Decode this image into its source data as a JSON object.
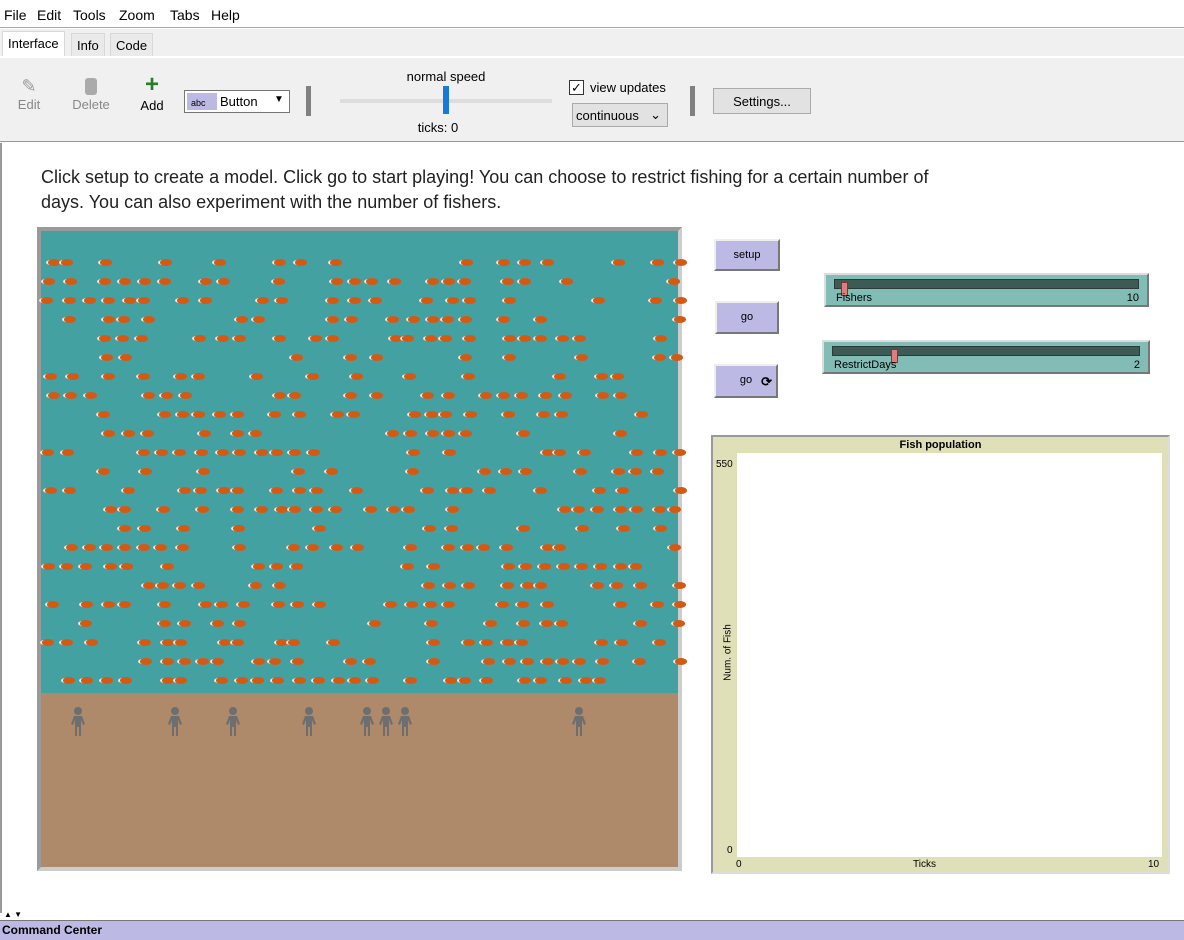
{
  "menu": [
    "File",
    "Edit",
    "Tools",
    "Zoom",
    "Tabs",
    "Help"
  ],
  "tabs": [
    "Interface",
    "Info",
    "Code"
  ],
  "toolbar": {
    "edit": "Edit",
    "delete": "Delete",
    "add": "Add",
    "widget_type": "Button",
    "speed_label": "normal speed",
    "speed_fraction": 0.5,
    "ticks": "ticks: 0",
    "view_updates_label": "view updates",
    "view_updates_checked": true,
    "update_mode": "continuous",
    "settings": "Settings..."
  },
  "info_text": "Click setup to create a model. Click go to start playing! You can choose to restrict fishing for a certain number of days. You can also experiment with the number of fishers.",
  "world": {
    "water_color": "#43a1a1",
    "land_color": "#ae8a6b",
    "fish_color": "#d45a14",
    "fisher_color": "#6e6e6e",
    "fisher_count": 8
  },
  "buttons": {
    "setup": "setup",
    "go_once": "go",
    "go_forever": "go"
  },
  "sliders": [
    {
      "label": "Fishers",
      "value": "10",
      "fraction": 0.03
    },
    {
      "label": "RestrictDays",
      "value": "2",
      "fraction": 0.2
    }
  ],
  "plot": {
    "title": "Fish population",
    "ylabel": "Num. of Fish",
    "xlabel": "Ticks",
    "ymax": "550",
    "ymin": "0",
    "xmin": "0",
    "xmax": "10"
  },
  "chart_data": {
    "type": "line",
    "title": "Fish population",
    "xlabel": "Ticks",
    "ylabel": "Num. of Fish",
    "xlim": [
      0,
      10
    ],
    "ylim": [
      0,
      550
    ],
    "series": []
  },
  "command_center": "Command Center"
}
